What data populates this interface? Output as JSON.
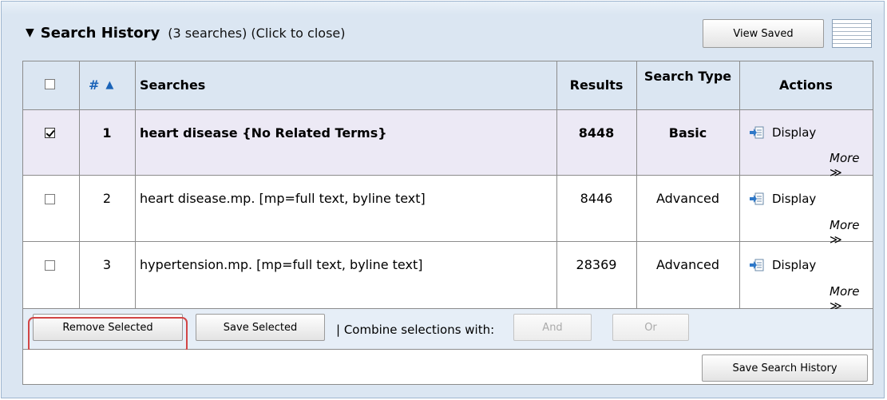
{
  "header": {
    "title": "Search History",
    "subtitle": "(3 searches) (Click to close)",
    "view_saved_label": "View Saved"
  },
  "table": {
    "columns": {
      "num": "#",
      "searches": "Searches",
      "results": "Results",
      "search_type": "Search Type",
      "actions": "Actions"
    },
    "rows": [
      {
        "num": "1",
        "query": "heart disease {No Related Terms}",
        "results": "8448",
        "type": "Basic",
        "checked": true,
        "display_label": "Display",
        "more_label": "More ≫"
      },
      {
        "num": "2",
        "query": "heart disease.mp. [mp=full text, byline text]",
        "results": "8446",
        "type": "Advanced",
        "checked": false,
        "display_label": "Display",
        "more_label": "More ≫"
      },
      {
        "num": "3",
        "query": "hypertension.mp. [mp=full text, byline text]",
        "results": "28369",
        "type": "Advanced",
        "checked": false,
        "display_label": "Display",
        "more_label": "More ≫"
      }
    ]
  },
  "footer": {
    "remove_selected_label": "Remove Selected",
    "save_selected_label": "Save Selected",
    "combine_label": "| Combine selections with:",
    "and_label": "And",
    "or_label": "Or",
    "save_history_label": "Save Search History"
  },
  "colors": {
    "panel_bg": "#dbe6f2",
    "highlight_row": "#ece9f5",
    "accent_blue": "#1a63b8",
    "callout_red": "#d24545"
  }
}
